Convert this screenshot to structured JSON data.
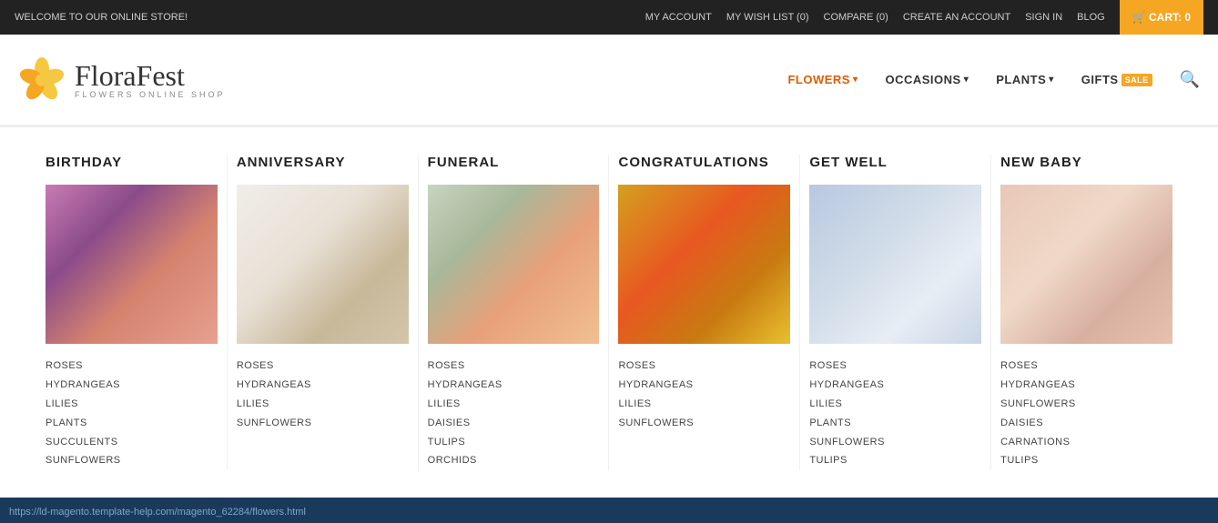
{
  "topbar": {
    "welcome": "WELCOME TO OUR ONLINE STORE!",
    "my_account": "MY ACCOUNT",
    "my_wish_list": "MY WISH LIST (0)",
    "compare": "COMPARE (0)",
    "create_account": "CREATE AN ACCOUNT",
    "sign_in": "SIGN IN",
    "blog": "BLOG",
    "cart": "🛒 CART: 0"
  },
  "logo": {
    "name": "FloraFest",
    "sub": "FLOWERS ONLINE SHOP",
    "flower_color": "#f5c842"
  },
  "nav": {
    "items": [
      {
        "label": "FLOWERS",
        "active": true,
        "has_dropdown": true
      },
      {
        "label": "OCCASIONS",
        "active": false,
        "has_dropdown": true
      },
      {
        "label": "PLANTS",
        "active": false,
        "has_dropdown": true
      },
      {
        "label": "GIFTS",
        "active": false,
        "has_sale": true,
        "has_dropdown": false
      }
    ]
  },
  "categories": [
    {
      "title": "BIRTHDAY",
      "img_class": "img-birthday",
      "links": [
        "ROSES",
        "HYDRANGEAS",
        "LILIES",
        "PLANTS",
        "SUCCULENTS",
        "SUNFLOWERS"
      ]
    },
    {
      "title": "ANNIVERSARY",
      "img_class": "img-anniversary",
      "links": [
        "ROSES",
        "HYDRANGEAS",
        "LILIES",
        "SUNFLOWERS"
      ]
    },
    {
      "title": "FUNERAL",
      "img_class": "img-funeral",
      "links": [
        "ROSES",
        "HYDRANGEAS",
        "LILIES",
        "DAISIES",
        "TULIPS",
        "ORCHIDS"
      ]
    },
    {
      "title": "CONGRATULATIONS",
      "img_class": "img-congratulations",
      "links": [
        "ROSES",
        "HYDRANGEAS",
        "LILIES",
        "SUNFLOWERS"
      ]
    },
    {
      "title": "GET WELL",
      "img_class": "img-getwell",
      "links": [
        "ROSES",
        "HYDRANGEAS",
        "LILIES",
        "PLANTS",
        "SUNFLOWERS",
        "TULIPS"
      ]
    },
    {
      "title": "NEW BABY",
      "img_class": "img-newbaby",
      "links": [
        "ROSES",
        "HYDRANGEAS",
        "SUNFLOWERS",
        "DAISIES",
        "CARNATIONS",
        "TULIPS"
      ]
    }
  ],
  "status_url": "https://ld-magento.template-help.com/magento_62284/flowers.html"
}
